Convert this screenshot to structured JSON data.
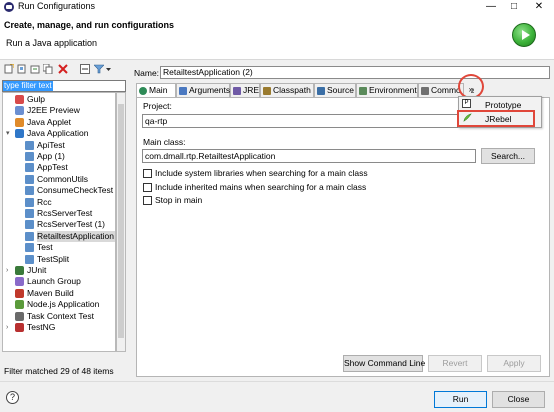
{
  "window": {
    "title": "Run Configurations",
    "minimize_glyph": "—",
    "maximize_glyph": "□",
    "close_glyph": "✕"
  },
  "header": {
    "title": "Create, manage, and run configurations",
    "subtitle": "Run a Java application",
    "logo_icon": "run-logo-icon"
  },
  "filter": {
    "value": "type filter text",
    "status": "Filter matched 29 of 48 items"
  },
  "tree": {
    "items": [
      {
        "label": "Gulp",
        "icon": "gulp-icon",
        "level": 1
      },
      {
        "label": "J2EE Preview",
        "icon": "j2ee-icon",
        "level": 1
      },
      {
        "label": "Java Applet",
        "icon": "java-applet-icon",
        "level": 1
      },
      {
        "label": "Java Application",
        "icon": "java-app-icon",
        "level": 1,
        "expanded": true
      },
      {
        "label": "ApiTest",
        "icon": "java-class-icon",
        "level": 2
      },
      {
        "label": "App (1)",
        "icon": "java-class-icon",
        "level": 2
      },
      {
        "label": "AppTest",
        "icon": "java-class-icon",
        "level": 2
      },
      {
        "label": "CommonUtils",
        "icon": "java-class-icon",
        "level": 2
      },
      {
        "label": "ConsumeCheckTest (1",
        "icon": "java-class-icon",
        "level": 2
      },
      {
        "label": "Rcc",
        "icon": "java-class-icon",
        "level": 2
      },
      {
        "label": "RcsServerTest",
        "icon": "java-class-icon",
        "level": 2
      },
      {
        "label": "RcsServerTest (1)",
        "icon": "java-class-icon",
        "level": 2
      },
      {
        "label": "RetailtestApplication (2",
        "icon": "java-class-icon",
        "level": 2,
        "selected": true
      },
      {
        "label": "Test",
        "icon": "java-class-icon",
        "level": 2
      },
      {
        "label": "TestSplit",
        "icon": "java-class-icon",
        "level": 2
      },
      {
        "label": "JUnit",
        "icon": "junit-icon",
        "level": 1,
        "collapsed": true
      },
      {
        "label": "Launch Group",
        "icon": "launch-group-icon",
        "level": 1
      },
      {
        "label": "Maven Build",
        "icon": "maven-icon",
        "level": 1
      },
      {
        "label": "Node.js Application",
        "icon": "nodejs-icon",
        "level": 1
      },
      {
        "label": "Task Context Test",
        "icon": "task-context-icon",
        "level": 1
      },
      {
        "label": "TestNG",
        "icon": "testng-icon",
        "level": 1,
        "collapsed": true
      }
    ]
  },
  "config": {
    "name_label": "Name:",
    "name_value": "RetailtestApplication (2)",
    "tabs": [
      {
        "label": "Main",
        "icon": "main-tab-icon",
        "active": true
      },
      {
        "label": "Arguments",
        "icon": "arguments-tab-icon"
      },
      {
        "label": "JRE",
        "icon": "jre-tab-icon"
      },
      {
        "label": "Classpath",
        "icon": "classpath-tab-icon"
      },
      {
        "label": "Source",
        "icon": "source-tab-icon"
      },
      {
        "label": "Environment",
        "icon": "environment-tab-icon"
      },
      {
        "label": "Commo",
        "icon": "common-tab-icon"
      }
    ],
    "overflow_glyph": "»",
    "overflow_count": "2",
    "project_label": "Project:",
    "project_value": "qa-rtp",
    "mainclass_label": "Main class:",
    "mainclass_value": "com.dmall.rtp.RetailtestApplication",
    "search_button": "Search...",
    "checkboxes": [
      {
        "label": "Include system libraries when searching for a main class",
        "checked": false
      },
      {
        "label": "Include inherited mains when searching for a main class",
        "checked": false
      },
      {
        "label": "Stop in main",
        "checked": false
      }
    ],
    "overflow_menu": [
      {
        "label": "Prototype",
        "icon": "prototype-icon"
      },
      {
        "label": "JRebel",
        "icon": "jrebel-icon"
      }
    ],
    "show_command_line_button": "Show Command Line",
    "revert_button": "Revert",
    "apply_button": "Apply"
  },
  "footer": {
    "help_glyph": "?",
    "run_button": "Run",
    "close_button": "Close"
  },
  "colors": {
    "annotation_red": "#e0473a",
    "selection_blue": "#3399ff",
    "run_green": "#3db33a"
  }
}
